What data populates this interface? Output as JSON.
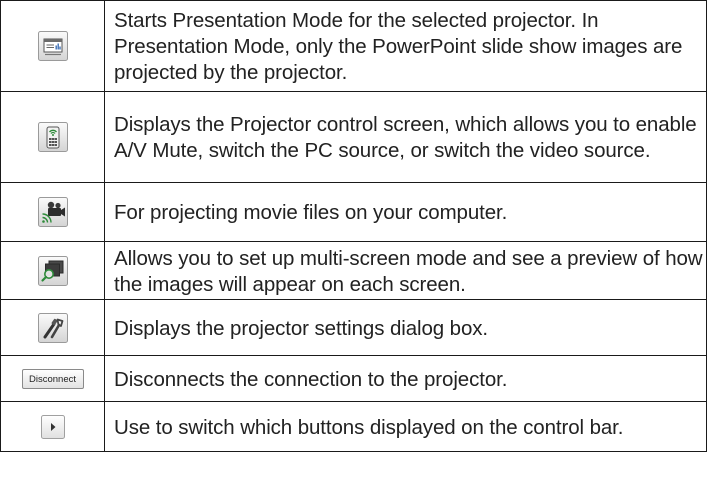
{
  "rows": [
    {
      "icon": "presentation-mode-icon",
      "description": "Starts Presentation Mode for the selected projector. In Presentation Mode, only the PowerPoint slide show images are projected by the projector."
    },
    {
      "icon": "projector-control-icon",
      "description": "Displays the Projector control screen, which allows you to enable A/V Mute, switch the PC source, or switch the video source."
    },
    {
      "icon": "movie-camera-icon",
      "description": "For projecting movie files on your computer."
    },
    {
      "icon": "multi-screen-preview-icon",
      "description": "Allows you to set up multi-screen mode and see a preview of how the images will appear on each screen."
    },
    {
      "icon": "settings-tools-icon",
      "description": "Displays the projector settings dialog box."
    },
    {
      "icon": "disconnect-button",
      "button_label": "Disconnect",
      "description": "Disconnects the connection to the projector."
    },
    {
      "icon": "arrow-right-icon",
      "description": "Use to switch which buttons displayed on the control bar."
    }
  ]
}
